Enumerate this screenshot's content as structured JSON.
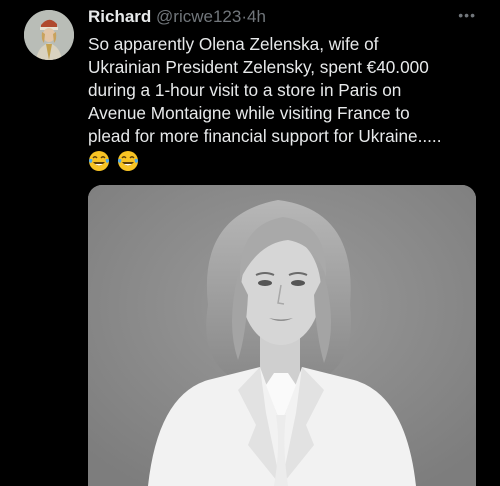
{
  "tweet": {
    "display_name": "Richard",
    "handle": "@ricwe123",
    "separator": "·",
    "time": "4h",
    "more_icon": "more-horizontal-icon",
    "text_lines": [
      "So apparently Olena Zelenska, wife of",
      "Ukrainian President Zelensky, spent €40.000",
      "during a 1-hour visit to a store in Paris on",
      "Avenue Montaigne while visiting France to",
      "plead for more financial support for Ukraine....."
    ],
    "emojis": [
      "face-with-tears-of-joy-icon",
      "face-with-tears-of-joy-icon"
    ]
  },
  "colors": {
    "background": "#000000",
    "text_primary": "#e7e9ea",
    "text_secondary": "#71767b",
    "photo_background": "#8f8f8f"
  }
}
